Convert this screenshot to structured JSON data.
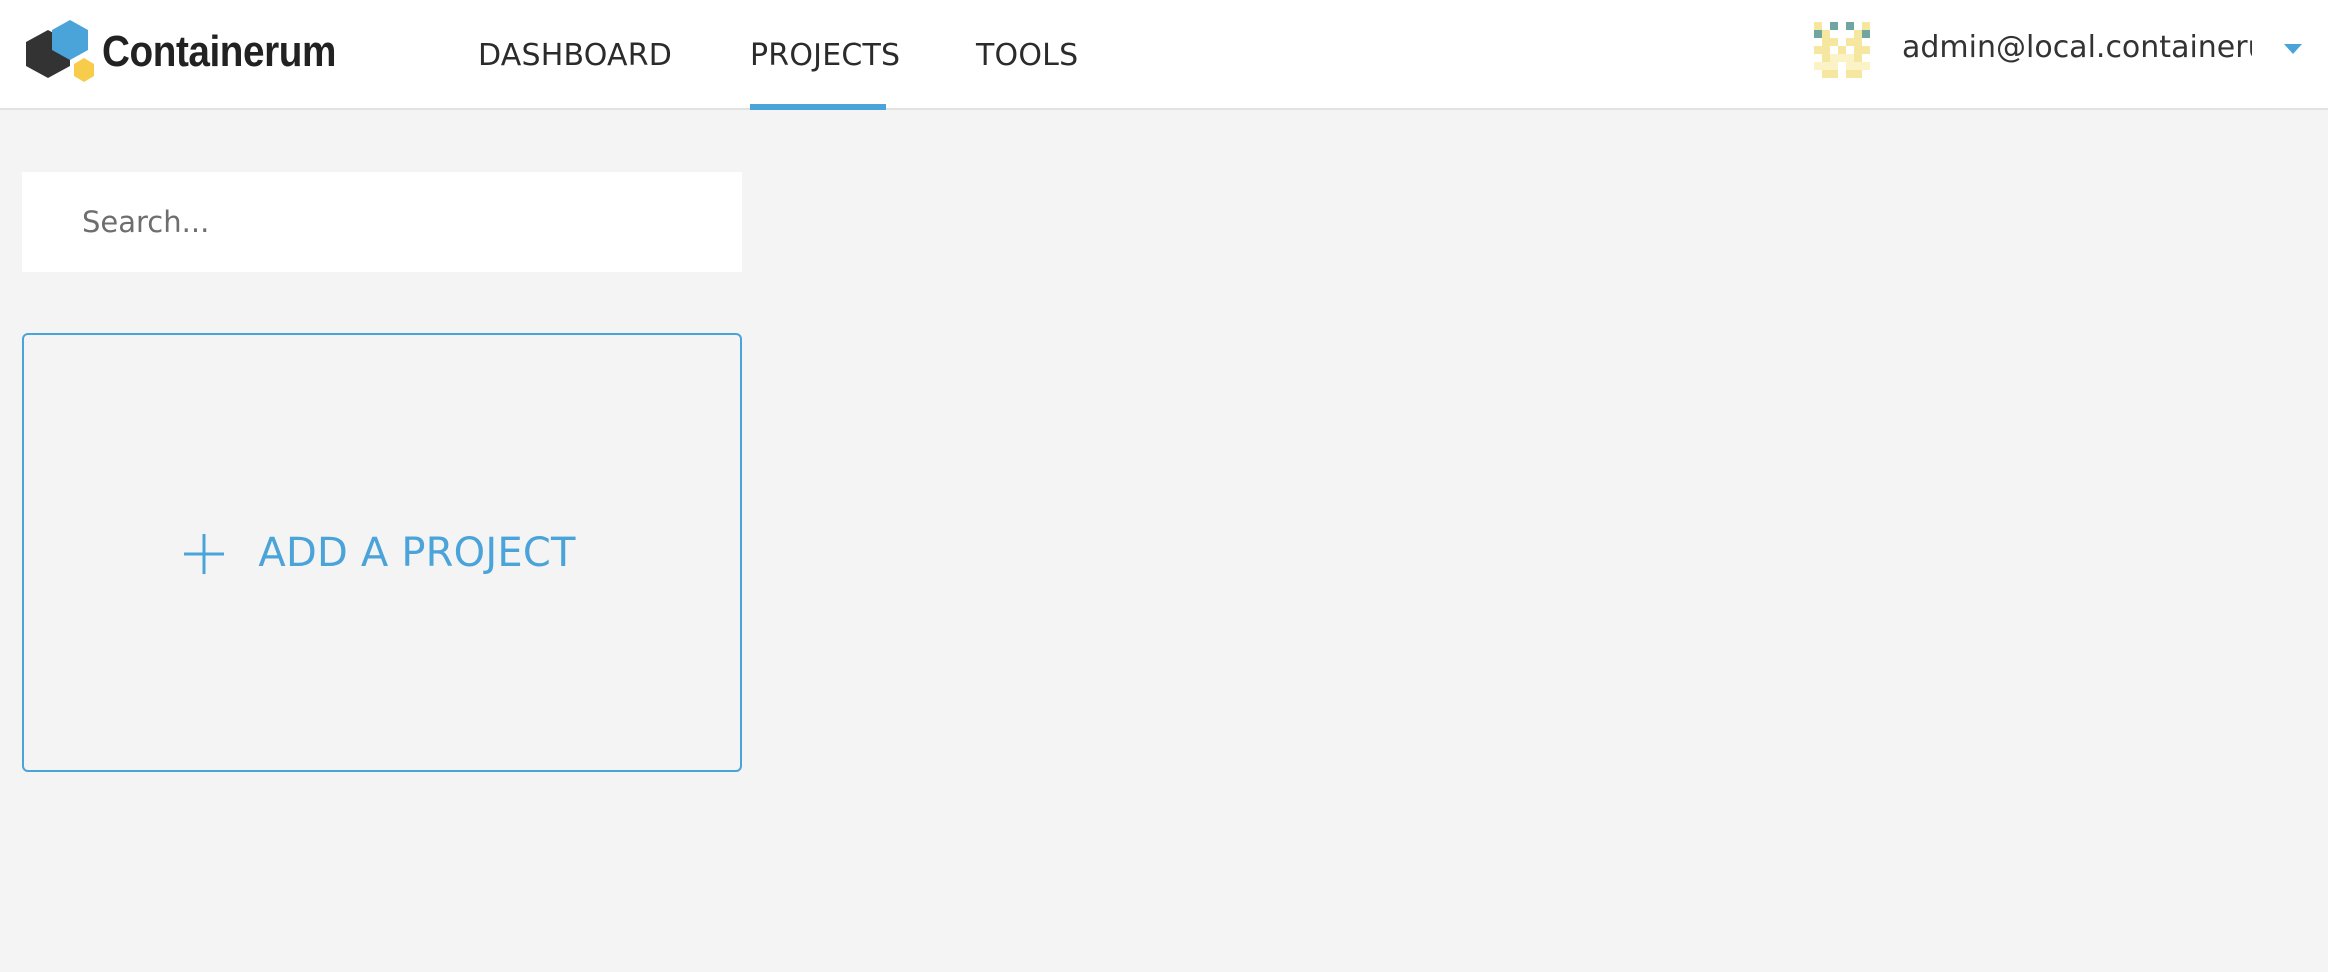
{
  "app": {
    "name": "Containerum"
  },
  "nav": {
    "items": [
      {
        "label": "DASHBOARD"
      },
      {
        "label": "PROJECTS"
      },
      {
        "label": "TOOLS"
      }
    ],
    "active": "PROJECTS"
  },
  "user": {
    "email": "admin@local.containeru..."
  },
  "search": {
    "placeholder": "Search...",
    "value": ""
  },
  "add_project": {
    "label": "ADD A PROJECT"
  },
  "colors": {
    "accent": "#4aa3d9",
    "logo_dark": "#333333",
    "logo_blue": "#4aa3d9",
    "logo_yellow": "#f7cc4a",
    "background": "#f4f4f4",
    "header": "#ffffff"
  },
  "icons": {
    "logo": "hexagon-logo-icon",
    "avatar": "identicon-avatar",
    "caret": "caret-down-icon",
    "add": "plus-icon"
  }
}
